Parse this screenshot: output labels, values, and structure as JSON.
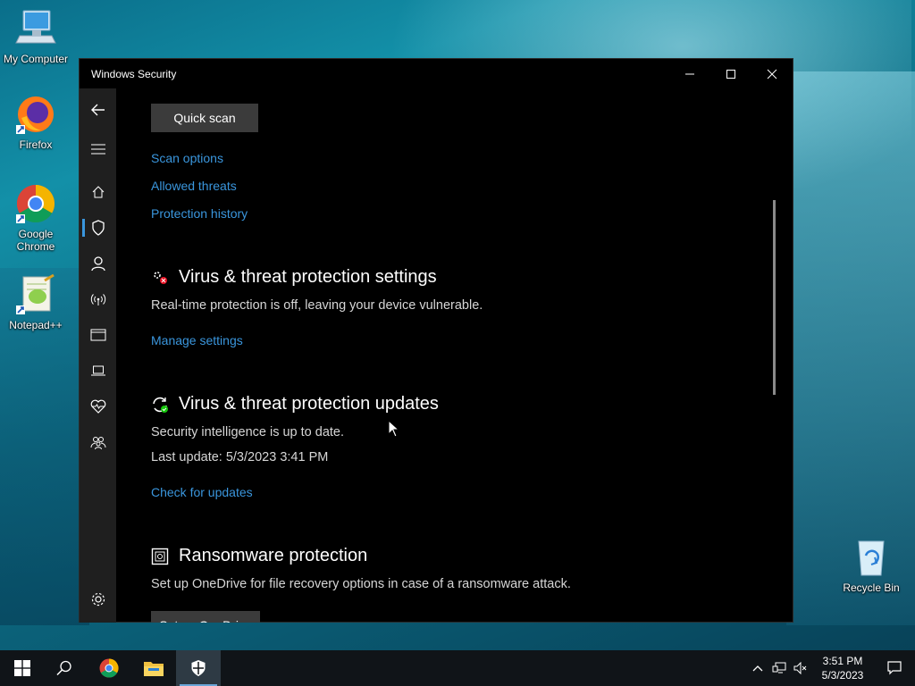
{
  "desktop": {
    "icons": [
      {
        "label": "My Computer"
      },
      {
        "label": "Firefox"
      },
      {
        "label": "Google Chrome"
      },
      {
        "label": "Notepad++"
      },
      {
        "label": "Recycle Bin"
      }
    ]
  },
  "window": {
    "title": "Windows Security",
    "controls": {
      "minimize": "–",
      "maximize": "☐",
      "close": "✕"
    }
  },
  "nav": {
    "items": [
      {
        "icon": "back-arrow-icon"
      },
      {
        "icon": "hamburger-menu-icon"
      },
      {
        "icon": "home-icon"
      },
      {
        "icon": "shield-icon",
        "active": true
      },
      {
        "icon": "account-person-icon"
      },
      {
        "icon": "network-wifi-icon"
      },
      {
        "icon": "app-browser-icon"
      },
      {
        "icon": "device-laptop-icon"
      },
      {
        "icon": "health-heart-icon"
      },
      {
        "icon": "family-icon"
      },
      {
        "icon": "settings-gear-icon"
      }
    ]
  },
  "content": {
    "quick_scan_label": "Quick scan",
    "links": {
      "scan_options": "Scan options",
      "allowed_threats": "Allowed threats",
      "protection_history": "Protection history"
    },
    "settings_section": {
      "heading": "Virus & threat protection settings",
      "description": "Real-time protection is off, leaving your device vulnerable.",
      "link": "Manage settings"
    },
    "updates_section": {
      "heading": "Virus & threat protection updates",
      "status": "Security intelligence is up to date.",
      "last_update": "Last update: 5/3/2023 3:41 PM",
      "link": "Check for updates"
    },
    "ransomware_section": {
      "heading": "Ransomware protection",
      "description": "Set up OneDrive for file recovery options in case of a ransomware attack.",
      "button": "Set up OneDrive"
    }
  },
  "colors": {
    "accent_link": "#3a96dd",
    "window_bg": "#000000",
    "nav_bg": "#1f1f1f",
    "button_bg": "#3b3b3b"
  },
  "taskbar": {
    "items": [
      {
        "icon": "windows-start-icon"
      },
      {
        "icon": "search-icon"
      },
      {
        "icon": "chrome-icon"
      },
      {
        "icon": "file-explorer-icon"
      },
      {
        "icon": "windows-security-shield-icon",
        "active": true
      }
    ],
    "tray": {
      "time": "3:51 PM",
      "date": "5/3/2023"
    }
  }
}
